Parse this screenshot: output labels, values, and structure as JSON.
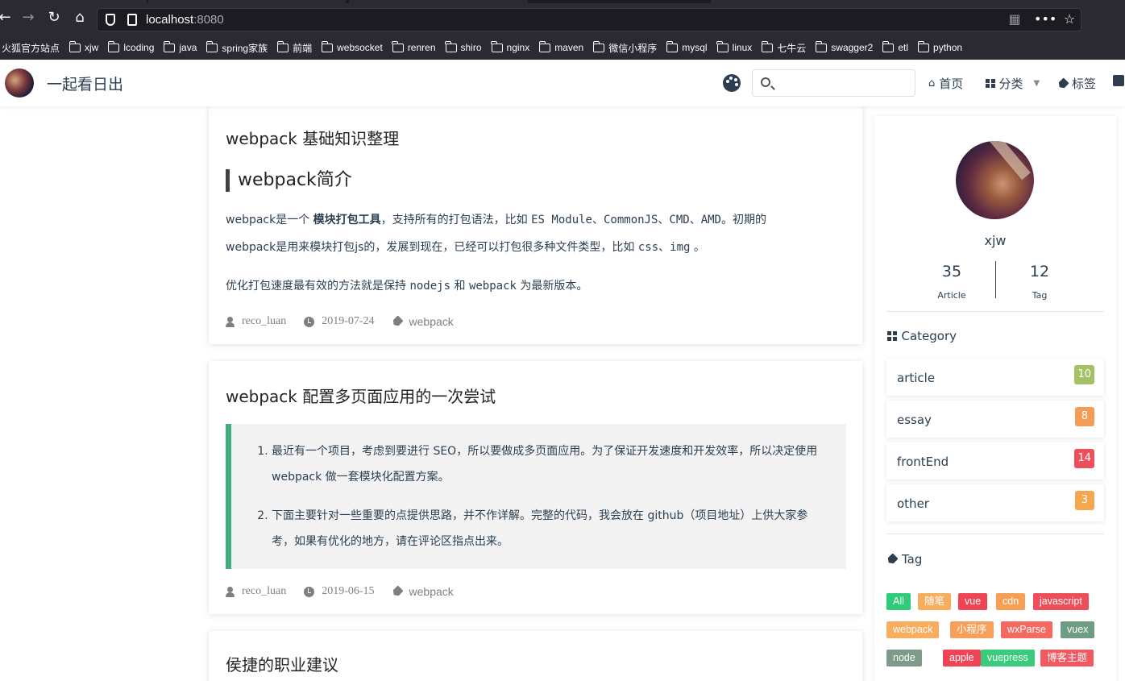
{
  "browser": {
    "url_host": "localhost",
    "url_port": ":8080",
    "bookmarks": [
      "火狐官方站点",
      "xjw",
      "lcoding",
      "java",
      "spring家族",
      "前端",
      "websocket",
      "renren",
      "shiro",
      "nginx",
      "maven",
      "微信小程序",
      "mysql",
      "linux",
      "七牛云",
      "swagger2",
      "etl",
      "python"
    ]
  },
  "header": {
    "title": "一起看日出",
    "search_placeholder": "",
    "nav": {
      "home": "首页",
      "category": "分类",
      "tags": "标签"
    }
  },
  "posts": [
    {
      "title": "webpack 基础知识整理",
      "subheading": "webpack简介",
      "p1_pre": "webpack是一个 ",
      "p1_bold": "模块打包工具",
      "p1_mid": "，支持所有的打包语法，比如 ",
      "p1_code": "ES Module、CommonJS、CMD、AMD",
      "p1_post": "。初期的",
      "p2_pre": "webpack是用来模块打包js的，发展到现在，已经可以打包很多种文件类型，比如 ",
      "p2_code": "css、img",
      "p2_post": " 。",
      "p3_pre": "优化打包速度最有效的方法就是保持 ",
      "p3_code1": "nodejs",
      "p3_mid": " 和 ",
      "p3_code2": "webpack",
      "p3_post": " 为最新版本。",
      "author": "reco_luan",
      "date": "2019-07-24",
      "tag": "webpack"
    },
    {
      "title": "webpack 配置多页面应用的一次尝试",
      "list": [
        "最近有一个项目，考虑到要进行 SEO，所以要做成多页面应用。为了保证开发速度和开发效率，所以决定使用 webpack 做一套模块化配置方案。",
        "下面主要针对一些重要的点提供思路，并不作详解。完整的代码，我会放在 github（项目地址）上供大家参考，如果有优化的地方，请在评论区指点出来。"
      ],
      "author": "reco_luan",
      "date": "2019-06-15",
      "tag": "webpack"
    },
    {
      "title": "侯捷的职业建议"
    }
  ],
  "sidebar": {
    "name": "xjw",
    "article_count": "35",
    "article_label": "Article",
    "tag_count": "12",
    "tag_label": "Tag",
    "category_title": "Category",
    "categories": [
      {
        "name": "article",
        "count": "10",
        "color": "#a4c165"
      },
      {
        "name": "essay",
        "count": "8",
        "color": "#f39c57"
      },
      {
        "name": "frontEnd",
        "count": "14",
        "color": "#ee4f5b"
      },
      {
        "name": "other",
        "count": "3",
        "color": "#f6a64d"
      }
    ],
    "tag_title": "Tag",
    "tags": [
      {
        "label": "All",
        "color": "#2fcb79"
      },
      {
        "label": "随笔",
        "color": "#f7ad5e"
      },
      {
        "label": "vue",
        "color": "#ee4453"
      },
      {
        "label": "cdn",
        "color": "#f7a055"
      },
      {
        "label": "javascript",
        "color": "#ed4e5a"
      },
      {
        "label": "webpack",
        "color": "#f9ad5f"
      },
      {
        "label": "小程序",
        "color": "#f8a05a"
      },
      {
        "label": "wxParse",
        "color": "#f46960"
      },
      {
        "label": "vuex",
        "color": "#6f9d84"
      },
      {
        "label": "node",
        "color": "#7d9b89"
      },
      {
        "label": "apple",
        "color": "#ef4456"
      },
      {
        "label": "vuepress",
        "color": "#3ccb7c"
      },
      {
        "label": "博客主题",
        "color": "#f2585f"
      }
    ]
  }
}
